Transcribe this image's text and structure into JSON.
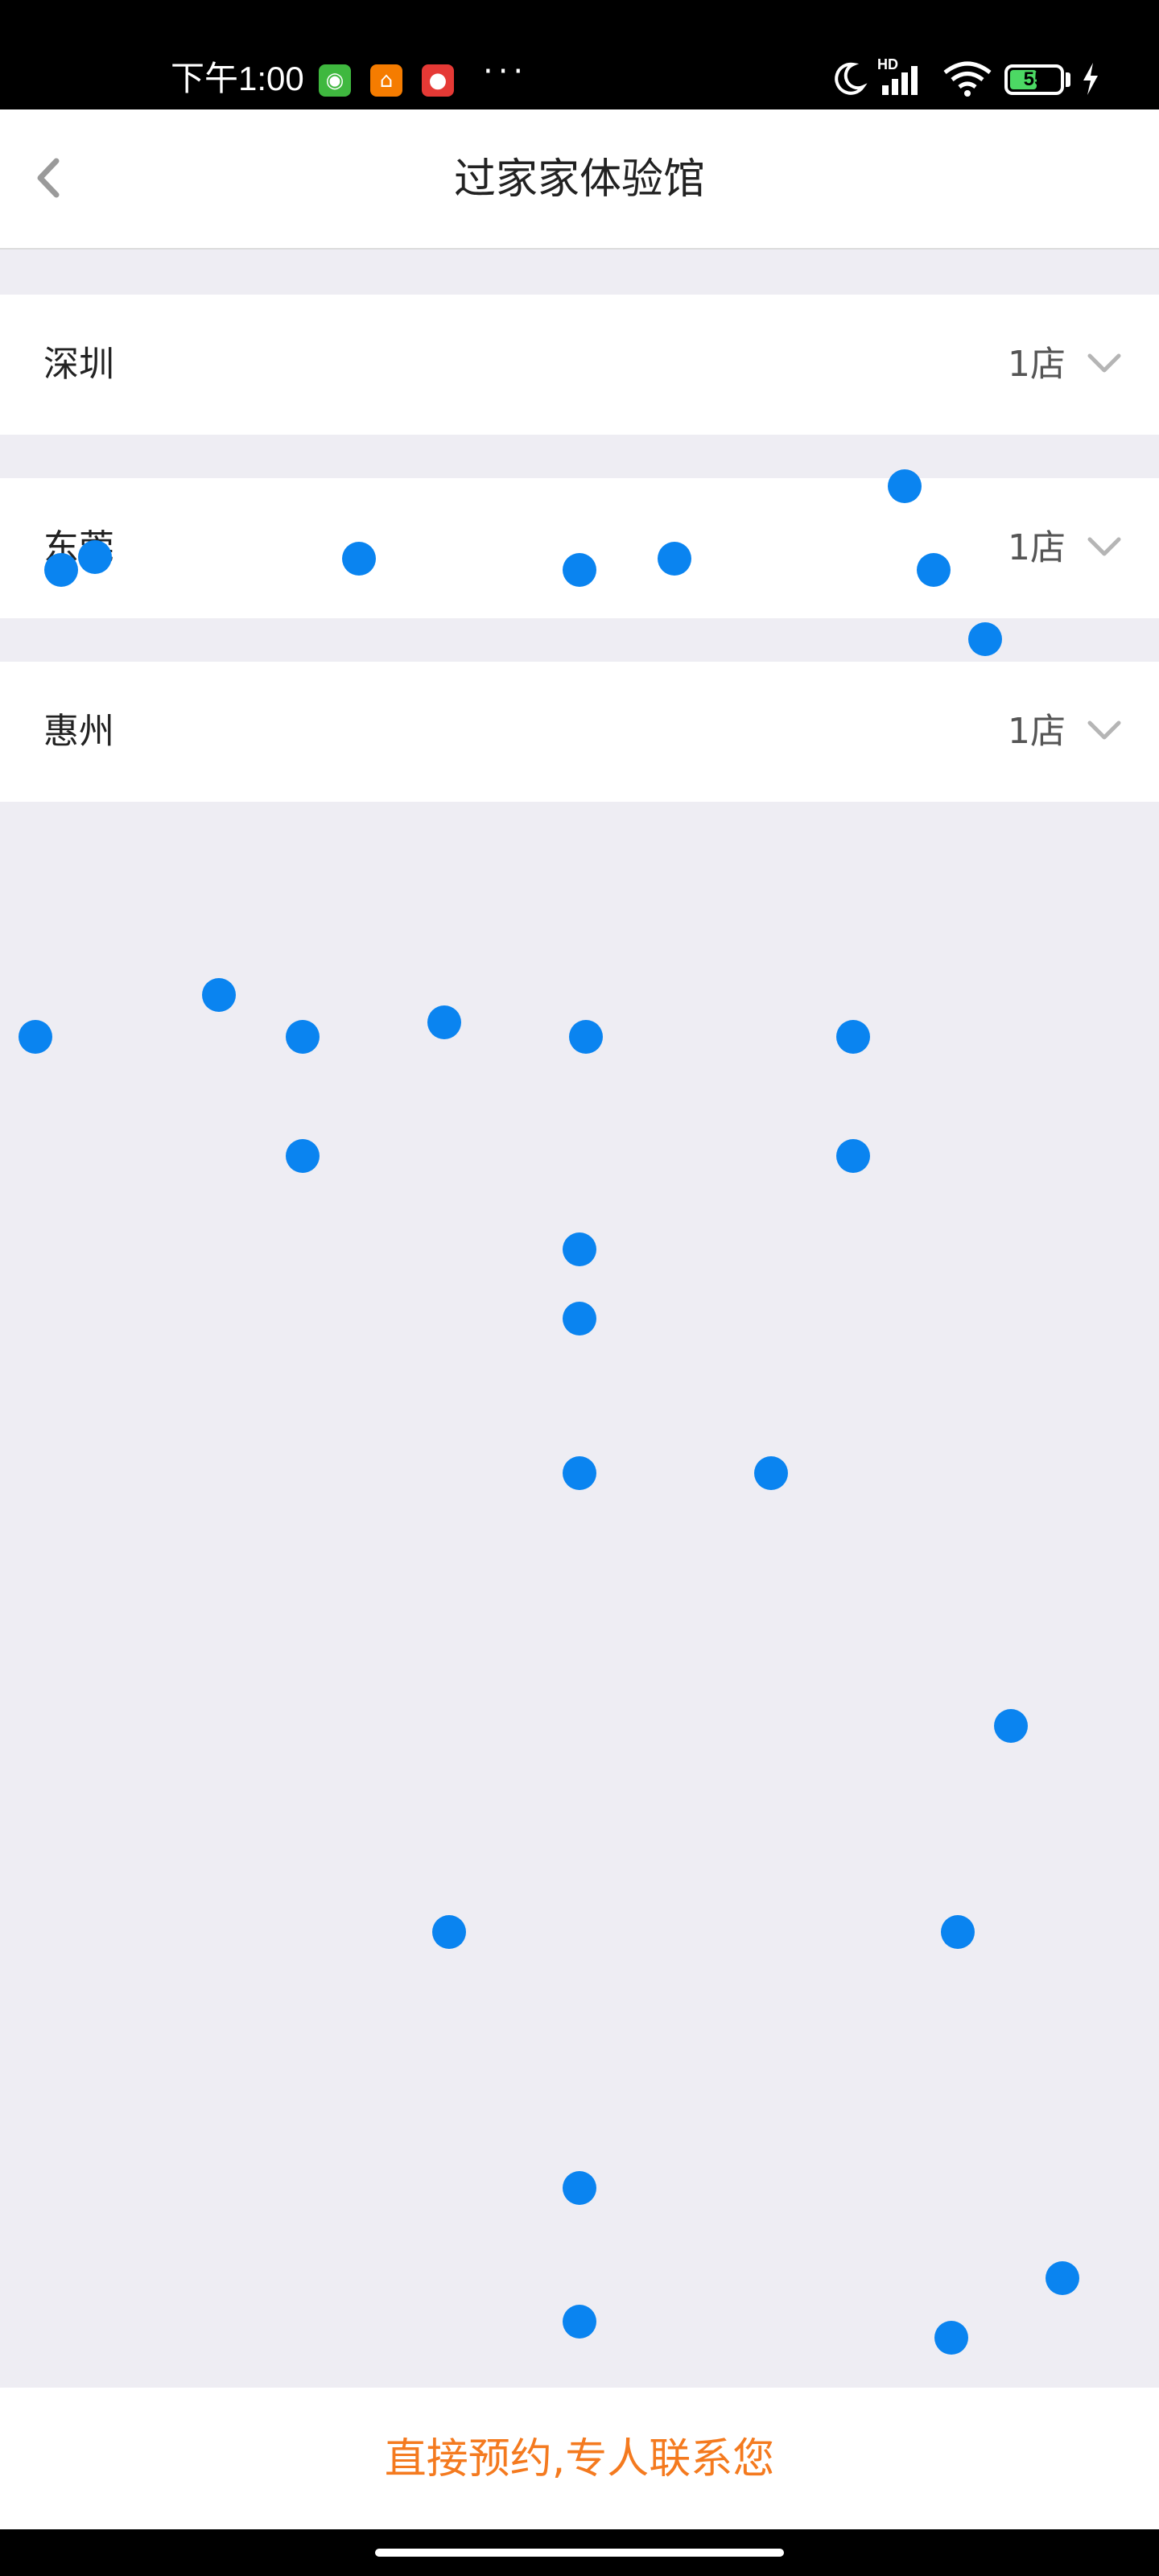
{
  "status_bar": {
    "time": "下午1:00",
    "apps": [
      {
        "icon": "green-robot-app-icon",
        "color": "#3fb83f",
        "glyph": "◉"
      },
      {
        "icon": "orange-home-app-icon",
        "color": "#f57c00",
        "glyph": "⌂"
      },
      {
        "icon": "red-dog-app-icon",
        "color": "#e53935",
        "glyph": "●"
      }
    ],
    "more": "···",
    "network": "HD",
    "battery": 55
  },
  "header": {
    "title": "过家家体验馆"
  },
  "cities": [
    {
      "name": "深圳",
      "count": "1店"
    },
    {
      "name": "东莞",
      "count": "1店"
    },
    {
      "name": "惠州",
      "count": "1店"
    }
  ],
  "footer": {
    "cta": "直接预约,专人联系您"
  },
  "colors": {
    "accent": "#f47a1f",
    "dot": "#0a84f0",
    "background": "#eeedf3"
  }
}
